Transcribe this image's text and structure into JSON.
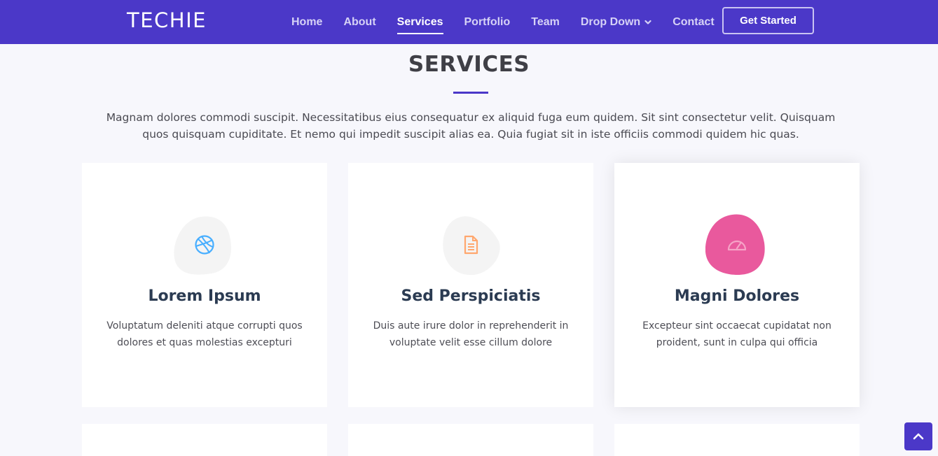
{
  "header": {
    "logo": "TECHIE",
    "nav": [
      {
        "label": "Home",
        "active": false
      },
      {
        "label": "About",
        "active": false
      },
      {
        "label": "Services",
        "active": true
      },
      {
        "label": "Portfolio",
        "active": false
      },
      {
        "label": "Team",
        "active": false
      },
      {
        "label": "Drop Down",
        "active": false
      },
      {
        "label": "Contact",
        "active": false
      }
    ],
    "cta_label": "Get Started"
  },
  "section": {
    "title": "SERVICES",
    "intro": "Magnam dolores commodi suscipit. Necessitatibus eius consequatur ex aliquid fuga eum quidem. Sit sint consectetur velit. Quisquam quos quisquam cupiditate. Et nemo qui impedit suscipit alias ea. Quia fugiat sit in iste officiis commodi quidem hic quas."
  },
  "services": [
    {
      "title": "Lorem Ipsum",
      "description": "Voluptatum deleniti atque corrupti quos dolores et quas molestias excepturi",
      "icon": "dribbble-icon",
      "icon_color": "#47aeff",
      "blob_color": "#f4f4f4"
    },
    {
      "title": "Sed Perspiciatis",
      "description": "Duis aute irure dolor in reprehenderit in voluptate velit esse cillum dolore",
      "icon": "file-text-icon",
      "icon_color": "#ffa76e",
      "blob_color": "#f4f4f4"
    },
    {
      "title": "Magni Dolores",
      "description": "Excepteur sint occaecat cupidatat non proident, sunt in culpa qui officia",
      "icon": "tachometer-icon",
      "icon_color": "#f6a3c7",
      "blob_color": "#e9599d"
    }
  ],
  "colors": {
    "brand": "#4b38c8",
    "background": "#f7f7fc",
    "heading": "#2b3b52"
  },
  "back_to_top_icon": "chevron-up-icon"
}
